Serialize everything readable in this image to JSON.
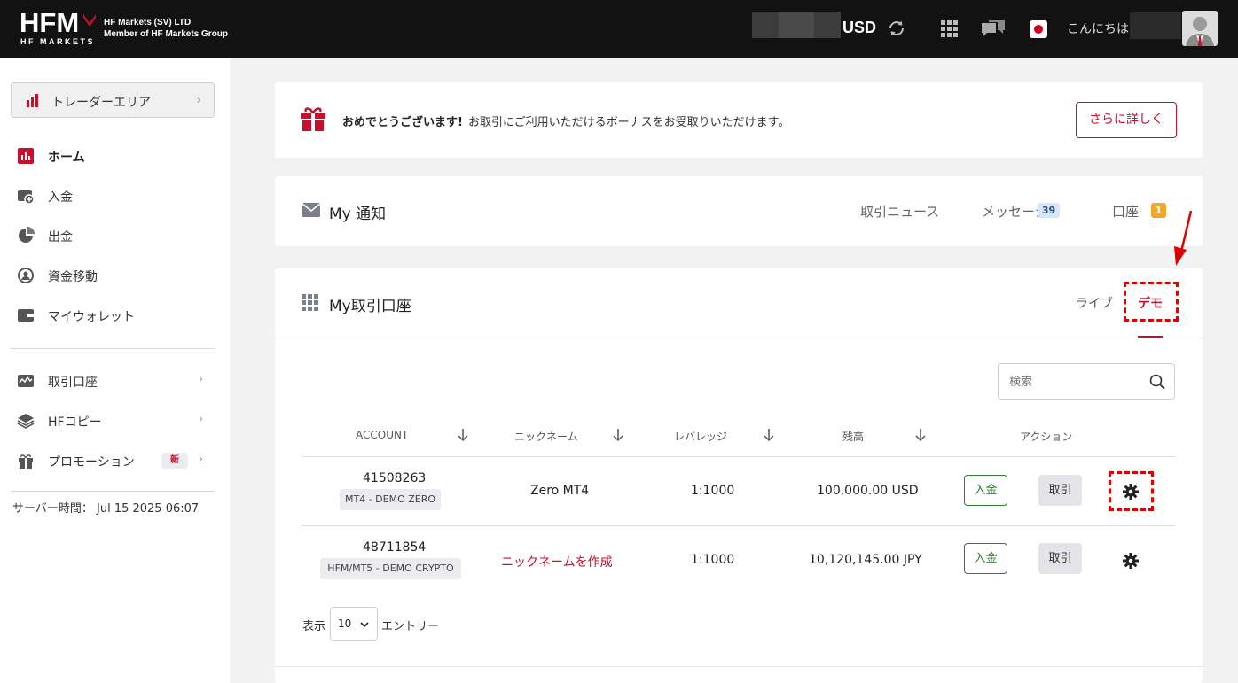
{
  "brand": {
    "logo_text": "HFM",
    "logo_subtext": "HF MARKETS",
    "company_line1": "HF Markets (SV) LTD",
    "company_line2": "Member of HF Markets Group"
  },
  "topbar": {
    "currency": "USD",
    "greeting": "こんにちは",
    "icons": [
      "refresh-icon",
      "apps-grid-icon",
      "chat-icon",
      "flag-japan-icon",
      "user-avatar"
    ]
  },
  "sidebar": {
    "trader_area": "トレーダーエリア",
    "items": [
      {
        "label": "ホーム",
        "icon": "home-chart-icon",
        "active": true
      },
      {
        "label": "入金",
        "icon": "deposit-icon"
      },
      {
        "label": "出金",
        "icon": "withdraw-icon"
      },
      {
        "label": "資金移動",
        "icon": "transfer-icon"
      },
      {
        "label": "マイウォレット",
        "icon": "wallet-icon"
      },
      {
        "label": "取引口座",
        "icon": "trading-account-icon",
        "has_chevron": true
      },
      {
        "label": "HFコピー",
        "icon": "layers-icon",
        "has_chevron": true
      },
      {
        "label": "プロモーション",
        "icon": "gift-icon",
        "has_chevron": true,
        "badge": "新"
      }
    ],
    "server_time": "サーバー時間： Jul 15 2025 06:07"
  },
  "bonus": {
    "headline": "おめでとうございます!",
    "text": "お取引にご利用いただけるボーナスをお受取りいただけます。",
    "button": "さらに詳しく"
  },
  "notifications": {
    "title": "My 通知",
    "tabs": [
      {
        "label": "取引ニュース"
      },
      {
        "label": "メッセージ",
        "count": "39"
      },
      {
        "label": "口座",
        "count": "1"
      }
    ]
  },
  "accounts": {
    "title": "My取引口座",
    "tab_live": "ライブ",
    "tab_demo": "デモ",
    "search_placeholder": "検索",
    "columns": [
      "ACCOUNT",
      "ニックネーム",
      "レバレッジ",
      "残高",
      "アクション"
    ],
    "rows": [
      {
        "number": "41508263",
        "type": "MT4 - DEMO ZERO",
        "nickname": "Zero MT4",
        "leverage": "1:1000",
        "balance": "100,000.00 USD",
        "deposit": "入金",
        "trade": "取引"
      },
      {
        "number": "48711854",
        "type": "HFM/MT5 - DEMO CRYPTO",
        "nickname": "ニックネームを作成",
        "leverage": "1:1000",
        "balance": "10,120,145.00 JPY",
        "deposit": "入金",
        "trade": "取引"
      }
    ],
    "show_label": "表示",
    "page_size": "10",
    "entries_label": "エントリー"
  },
  "colors": {
    "brand_red": "#c8102e",
    "topbar": "#121212",
    "deposit_green": "#2e7d32",
    "message_badge": "#d6e7fb",
    "account_badge": "#f5a623"
  }
}
